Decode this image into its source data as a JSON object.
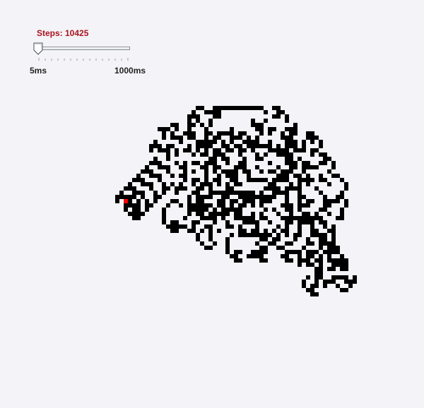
{
  "status": {
    "steps_text": "Steps: 10425"
  },
  "speed_slider": {
    "min_label": "5ms",
    "max_label": "1000ms",
    "value_fraction": 0.0
  },
  "colors": {
    "steps_text": "#a8141e",
    "cell_on": "#000000",
    "ant": "#ff0000",
    "background": "#f4f3f7"
  }
}
